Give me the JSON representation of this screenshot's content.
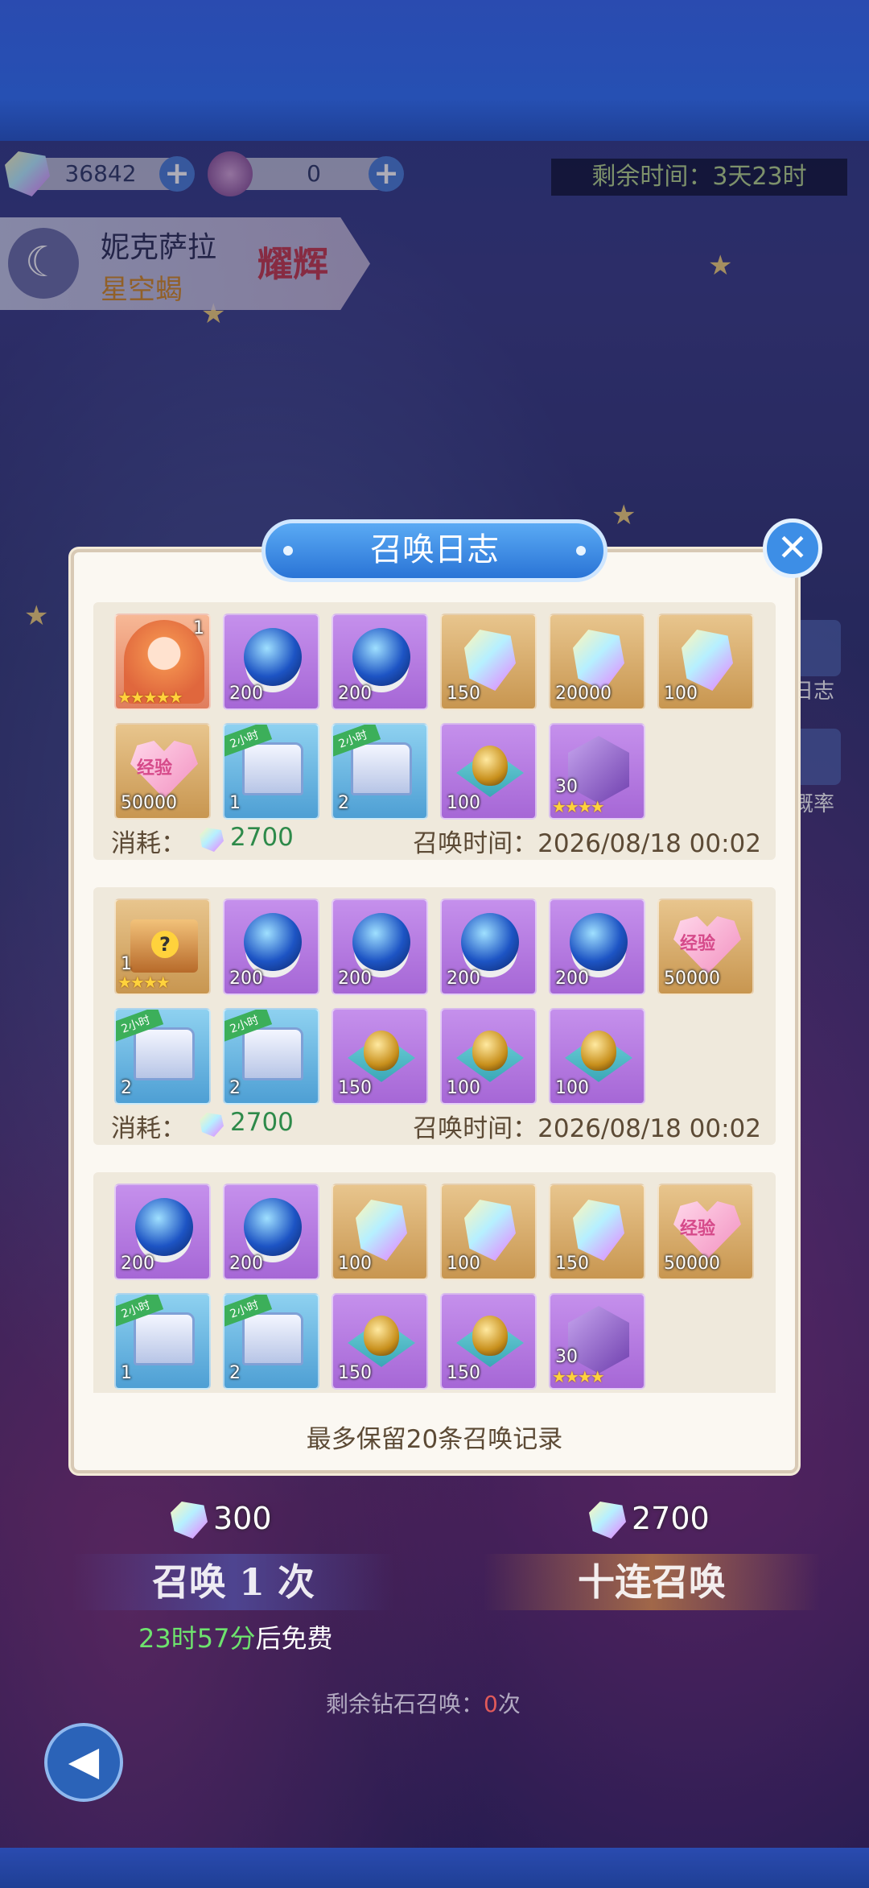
{
  "currency": {
    "gems": "36842",
    "tickets": "0",
    "plus": "+",
    "timer": "剩余时间：3天23时"
  },
  "hero": {
    "name": "妮克萨拉",
    "subtitle": "星空蝎",
    "tag": "耀辉",
    "icon": "moon-icon"
  },
  "side": {
    "log_label": "日志",
    "rate_label": "概率"
  },
  "dialog": {
    "title": "召唤日志",
    "close": "✕",
    "footer": "最多保留20条召唤记录",
    "entries": [
      {
        "items": [
          {
            "kind": "hero",
            "qty": "1",
            "stars": "★★★★★"
          },
          {
            "kind": "orb",
            "qty": "200"
          },
          {
            "kind": "orb",
            "qty": "200"
          },
          {
            "kind": "crystal",
            "qty": "150"
          },
          {
            "kind": "crystal",
            "qty": "20000"
          },
          {
            "kind": "crystal",
            "qty": "100"
          },
          {
            "kind": "exp-heart",
            "qty": "50000",
            "label": "经验"
          },
          {
            "kind": "chest",
            "qty": "1",
            "tag": "2小时"
          },
          {
            "kind": "chest",
            "qty": "2",
            "tag": "2小时"
          },
          {
            "kind": "egg",
            "qty": "100"
          },
          {
            "kind": "shard",
            "qty": "30",
            "stars": "★★★★"
          }
        ],
        "cost_label": "消耗：",
        "cost": "2700",
        "time_label": "召唤时间：",
        "time": "2026/08/18 00:02"
      },
      {
        "items": [
          {
            "kind": "box",
            "qty": "1",
            "stars": "★★★★"
          },
          {
            "kind": "orb",
            "qty": "200"
          },
          {
            "kind": "orb",
            "qty": "200"
          },
          {
            "kind": "orb",
            "qty": "200"
          },
          {
            "kind": "orb",
            "qty": "200"
          },
          {
            "kind": "exp-heart",
            "qty": "50000",
            "label": "经验"
          },
          {
            "kind": "chest",
            "qty": "2",
            "tag": "2小时"
          },
          {
            "kind": "chest",
            "qty": "2",
            "tag": "2小时"
          },
          {
            "kind": "egg",
            "qty": "150"
          },
          {
            "kind": "egg",
            "qty": "100"
          },
          {
            "kind": "egg",
            "qty": "100"
          }
        ],
        "cost_label": "消耗：",
        "cost": "2700",
        "time_label": "召唤时间：",
        "time": "2026/08/18 00:02"
      },
      {
        "items": [
          {
            "kind": "orb",
            "qty": "200"
          },
          {
            "kind": "orb",
            "qty": "200"
          },
          {
            "kind": "crystal",
            "qty": "100"
          },
          {
            "kind": "crystal",
            "qty": "100"
          },
          {
            "kind": "crystal",
            "qty": "150"
          },
          {
            "kind": "exp-heart",
            "qty": "50000",
            "label": "经验"
          },
          {
            "kind": "chest",
            "qty": "1",
            "tag": "2小时"
          },
          {
            "kind": "chest",
            "qty": "2",
            "tag": "2小时"
          },
          {
            "kind": "egg",
            "qty": "150"
          },
          {
            "kind": "egg",
            "qty": "150"
          },
          {
            "kind": "shard",
            "qty": "30",
            "stars": "★★★★"
          }
        ]
      }
    ]
  },
  "summon": {
    "single_cost": "300",
    "ten_cost": "2700",
    "single_label": "召唤 1 次",
    "ten_label": "十连召唤",
    "free_time": "23时57分",
    "free_suffix": "后免费",
    "remaining_label": "剩余钻石召唤：",
    "remaining_value": "0",
    "remaining_unit": "次"
  },
  "back": {
    "icon": "back-arrow-icon"
  }
}
